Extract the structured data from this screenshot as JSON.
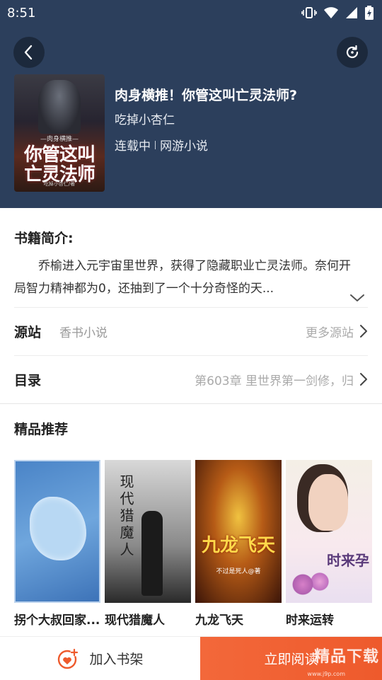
{
  "status_bar": {
    "time": "8:51"
  },
  "book": {
    "title": "肉身横推！你管这叫亡灵法师?",
    "author": "吃掉小杏仁",
    "status": "连载中",
    "category": "网游小说",
    "cover": {
      "top_text": "—肉身横推—",
      "title_text": "你管这叫亡灵法师",
      "author_text": "吃掉小杏仁/著"
    }
  },
  "intro": {
    "label": "书籍简介:",
    "text": "乔榆进入元宇宙里世界，获得了隐藏职业亡灵法师。奈何开局智力精神都为0，还抽到了一个十分奇怪的天..."
  },
  "source": {
    "label": "源站",
    "value": "香书小说",
    "more": "更多源站"
  },
  "toc": {
    "label": "目录",
    "latest": "第603章 里世界第一剑修，归"
  },
  "recommend": {
    "label": "精品推荐",
    "items": [
      {
        "title": "拐个大叔回家...",
        "cover_text": ""
      },
      {
        "title": "现代猎魔人",
        "cover_text": "现代猎魔人"
      },
      {
        "title": "九龙飞天",
        "cover_text": "九龙飞天",
        "cover_sub": "不过是死人@著"
      },
      {
        "title": "时来运转",
        "cover_text": "时来孕"
      }
    ]
  },
  "bottom": {
    "add_shelf": "加入书架",
    "read_now": "立即阅读",
    "watermark": "精品下载",
    "watermark_sub": "www.j9p.com"
  },
  "colors": {
    "header_bg": "#2c3f5c",
    "accent": "#ee5a2c"
  }
}
